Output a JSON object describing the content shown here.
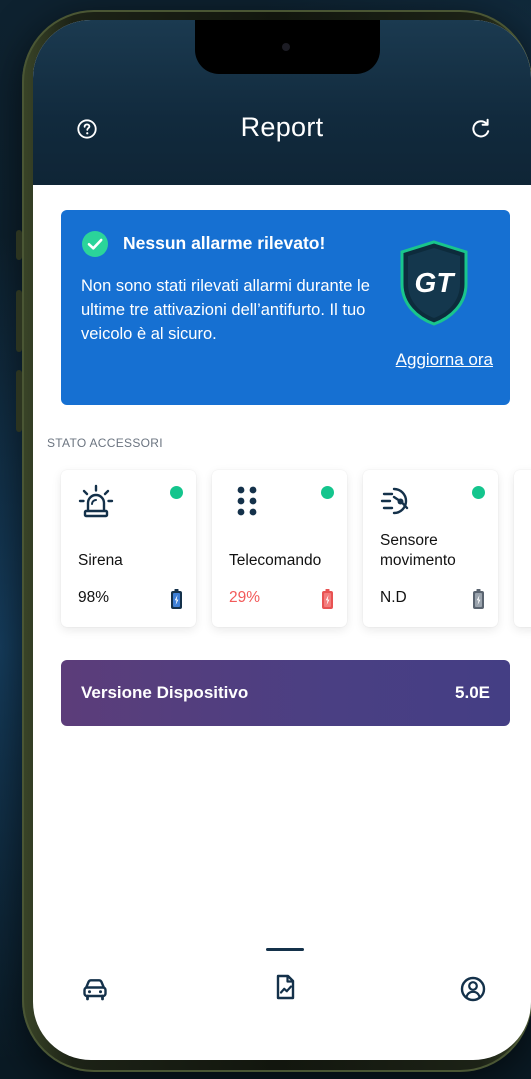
{
  "header": {
    "title": "Report",
    "help_icon": "help-circle-icon",
    "refresh_icon": "refresh-icon"
  },
  "alert": {
    "title": "Nessun allarme rilevato!",
    "message": "Non sono stati rilevati allarmi durante le ultime tre attivazioni dell’antifurto. Il tuo veicolo è al sicuro.",
    "action": "Aggiorna ora",
    "logo_text": "GT",
    "color": "#1670d2"
  },
  "accessories": {
    "section_label": "STATO ACCESSORI",
    "items": [
      {
        "name": "Sirena",
        "battery": "98%",
        "battery_low": false,
        "icon": "siren-icon"
      },
      {
        "name": "Telecomando",
        "battery": "29%",
        "battery_low": true,
        "icon": "keypad-icon"
      },
      {
        "name": "Sensore movimento",
        "battery": "N.D",
        "battery_low": false,
        "icon": "motion-sensor-icon"
      }
    ],
    "status_color": "#14c58d"
  },
  "device": {
    "label": "Versione Dispositivo",
    "version": "5.0E"
  },
  "nav": {
    "items": [
      {
        "icon": "car-icon",
        "active": false
      },
      {
        "icon": "report-icon",
        "active": true
      },
      {
        "icon": "user-icon",
        "active": false
      }
    ]
  }
}
